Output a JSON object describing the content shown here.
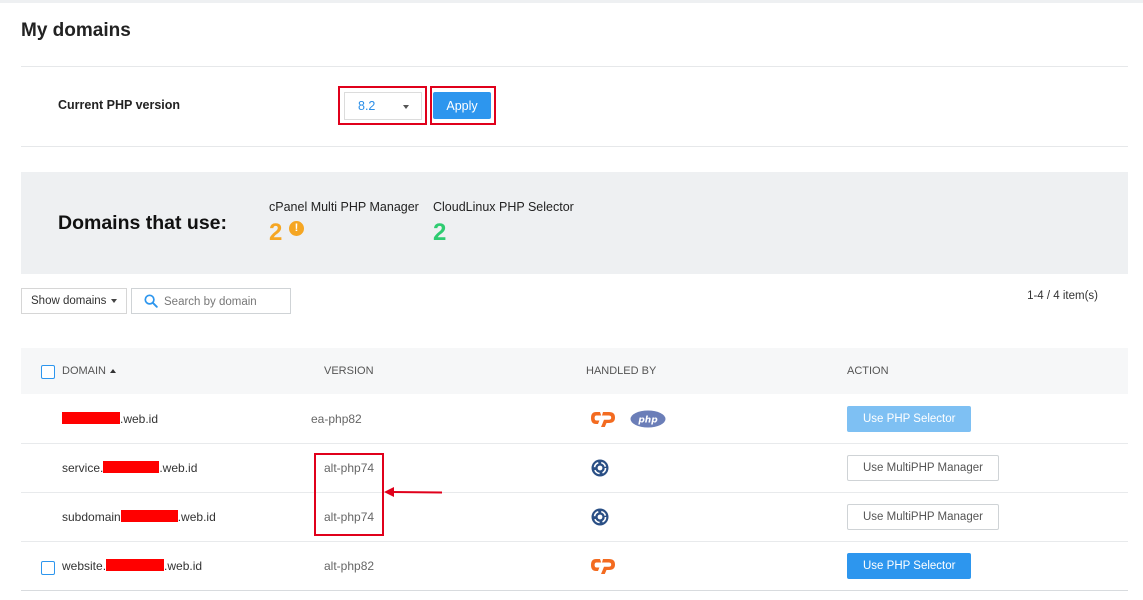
{
  "page": {
    "title": "My domains"
  },
  "php_version": {
    "label": "Current PHP version",
    "selected": "8.2",
    "apply_label": "Apply"
  },
  "summary": {
    "title": "Domains that use:",
    "cpanel": {
      "label": "cPanel Multi PHP Manager",
      "count": "2",
      "info_icon": "!"
    },
    "cloudlinux": {
      "label": "CloudLinux PHP Selector",
      "count": "2"
    }
  },
  "toolbar": {
    "show_domains_label": "Show domains",
    "search_placeholder": "Search by domain",
    "items_count": "1-4 / 4 item(s)"
  },
  "table": {
    "columns": {
      "domain": "DOMAIN",
      "version": "VERSION",
      "handled_by": "HANDLED BY",
      "action": "ACTION"
    },
    "rows": [
      {
        "prefix": "",
        "suffix": ".web.id",
        "version": "ea-php82",
        "handled_by": [
          "cpanel-logo-icon",
          "php-logo-icon"
        ],
        "action": "Use PHP Selector"
      },
      {
        "prefix": "service.",
        "suffix": ".web.id",
        "version": "alt-php74",
        "handled_by": [
          "cloudlinux-logo-icon"
        ],
        "action": "Use MultiPHP Manager"
      },
      {
        "prefix": "subdomain",
        "suffix": ".web.id",
        "version": "alt-php74",
        "handled_by": [
          "cloudlinux-logo-icon"
        ],
        "action": "Use MultiPHP Manager"
      },
      {
        "prefix": "website.",
        "suffix": ".web.id",
        "version": "alt-php82",
        "handled_by": [
          "cpanel-logo-icon"
        ],
        "action": "Use PHP Selector"
      }
    ]
  },
  "php_logo_text": "php",
  "colors": {
    "accent": "#2d96ee",
    "cpanel_count": "#f5a623",
    "cloudlinux_count": "#2ecc71",
    "highlight": "#e0001b",
    "redaction": "#ff0000"
  }
}
